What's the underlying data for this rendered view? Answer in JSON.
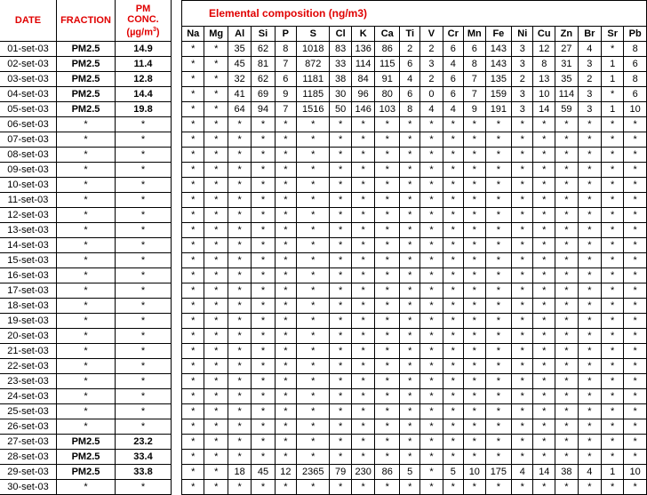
{
  "left_headers": {
    "date": "DATE",
    "fraction": "FRACTION",
    "pm_line1": "PM",
    "pm_line2": "CONC.",
    "pm_unit": "(µg/m",
    "pm_unit_sup": "3",
    "pm_unit_close": ")"
  },
  "composition_title": "Elemental composition (ng/m3)",
  "elements": [
    "Na",
    "Mg",
    "Al",
    "Si",
    "P",
    "S",
    "Cl",
    "K",
    "Ca",
    "Ti",
    "V",
    "Cr",
    "Mn",
    "Fe",
    "Ni",
    "Cu",
    "Zn",
    "Br",
    "Sr",
    "Pb"
  ],
  "rows": [
    {
      "date": "01-set-03",
      "fraction": "PM2.5",
      "conc": "14.9",
      "values": [
        "*",
        "*",
        "35",
        "62",
        "8",
        "1018",
        "83",
        "136",
        "86",
        "2",
        "2",
        "6",
        "6",
        "143",
        "3",
        "12",
        "27",
        "4",
        "*",
        "8"
      ]
    },
    {
      "date": "02-set-03",
      "fraction": "PM2.5",
      "conc": "11.4",
      "values": [
        "*",
        "*",
        "45",
        "81",
        "7",
        "872",
        "33",
        "114",
        "115",
        "6",
        "3",
        "4",
        "8",
        "143",
        "3",
        "8",
        "31",
        "3",
        "1",
        "6"
      ]
    },
    {
      "date": "03-set-03",
      "fraction": "PM2.5",
      "conc": "12.8",
      "values": [
        "*",
        "*",
        "32",
        "62",
        "6",
        "1181",
        "38",
        "84",
        "91",
        "4",
        "2",
        "6",
        "7",
        "135",
        "2",
        "13",
        "35",
        "2",
        "1",
        "8"
      ]
    },
    {
      "date": "04-set-03",
      "fraction": "PM2.5",
      "conc": "14.4",
      "values": [
        "*",
        "*",
        "41",
        "69",
        "9",
        "1185",
        "30",
        "96",
        "80",
        "6",
        "0",
        "6",
        "7",
        "159",
        "3",
        "10",
        "114",
        "3",
        "*",
        "6"
      ]
    },
    {
      "date": "05-set-03",
      "fraction": "PM2.5",
      "conc": "19.8",
      "values": [
        "*",
        "*",
        "64",
        "94",
        "7",
        "1516",
        "50",
        "146",
        "103",
        "8",
        "4",
        "4",
        "9",
        "191",
        "3",
        "14",
        "59",
        "3",
        "1",
        "10"
      ]
    },
    {
      "date": "06-set-03",
      "fraction": "*",
      "conc": "*",
      "values": [
        "*",
        "*",
        "*",
        "*",
        "*",
        "*",
        "*",
        "*",
        "*",
        "*",
        "*",
        "*",
        "*",
        "*",
        "*",
        "*",
        "*",
        "*",
        "*",
        "*"
      ]
    },
    {
      "date": "07-set-03",
      "fraction": "*",
      "conc": "*",
      "values": [
        "*",
        "*",
        "*",
        "*",
        "*",
        "*",
        "*",
        "*",
        "*",
        "*",
        "*",
        "*",
        "*",
        "*",
        "*",
        "*",
        "*",
        "*",
        "*",
        "*"
      ]
    },
    {
      "date": "08-set-03",
      "fraction": "*",
      "conc": "*",
      "values": [
        "*",
        "*",
        "*",
        "*",
        "*",
        "*",
        "*",
        "*",
        "*",
        "*",
        "*",
        "*",
        "*",
        "*",
        "*",
        "*",
        "*",
        "*",
        "*",
        "*"
      ]
    },
    {
      "date": "09-set-03",
      "fraction": "*",
      "conc": "*",
      "values": [
        "*",
        "*",
        "*",
        "*",
        "*",
        "*",
        "*",
        "*",
        "*",
        "*",
        "*",
        "*",
        "*",
        "*",
        "*",
        "*",
        "*",
        "*",
        "*",
        "*"
      ]
    },
    {
      "date": "10-set-03",
      "fraction": "*",
      "conc": "*",
      "values": [
        "*",
        "*",
        "*",
        "*",
        "*",
        "*",
        "*",
        "*",
        "*",
        "*",
        "*",
        "*",
        "*",
        "*",
        "*",
        "*",
        "*",
        "*",
        "*",
        "*"
      ]
    },
    {
      "date": "11-set-03",
      "fraction": "*",
      "conc": "*",
      "values": [
        "*",
        "*",
        "*",
        "*",
        "*",
        "*",
        "*",
        "*",
        "*",
        "*",
        "*",
        "*",
        "*",
        "*",
        "*",
        "*",
        "*",
        "*",
        "*",
        "*"
      ]
    },
    {
      "date": "12-set-03",
      "fraction": "*",
      "conc": "*",
      "values": [
        "*",
        "*",
        "*",
        "*",
        "*",
        "*",
        "*",
        "*",
        "*",
        "*",
        "*",
        "*",
        "*",
        "*",
        "*",
        "*",
        "*",
        "*",
        "*",
        "*"
      ]
    },
    {
      "date": "13-set-03",
      "fraction": "*",
      "conc": "*",
      "values": [
        "*",
        "*",
        "*",
        "*",
        "*",
        "*",
        "*",
        "*",
        "*",
        "*",
        "*",
        "*",
        "*",
        "*",
        "*",
        "*",
        "*",
        "*",
        "*",
        "*"
      ]
    },
    {
      "date": "14-set-03",
      "fraction": "*",
      "conc": "*",
      "values": [
        "*",
        "*",
        "*",
        "*",
        "*",
        "*",
        "*",
        "*",
        "*",
        "*",
        "*",
        "*",
        "*",
        "*",
        "*",
        "*",
        "*",
        "*",
        "*",
        "*"
      ]
    },
    {
      "date": "15-set-03",
      "fraction": "*",
      "conc": "*",
      "values": [
        "*",
        "*",
        "*",
        "*",
        "*",
        "*",
        "*",
        "*",
        "*",
        "*",
        "*",
        "*",
        "*",
        "*",
        "*",
        "*",
        "*",
        "*",
        "*",
        "*"
      ]
    },
    {
      "date": "16-set-03",
      "fraction": "*",
      "conc": "*",
      "values": [
        "*",
        "*",
        "*",
        "*",
        "*",
        "*",
        "*",
        "*",
        "*",
        "*",
        "*",
        "*",
        "*",
        "*",
        "*",
        "*",
        "*",
        "*",
        "*",
        "*"
      ]
    },
    {
      "date": "17-set-03",
      "fraction": "*",
      "conc": "*",
      "values": [
        "*",
        "*",
        "*",
        "*",
        "*",
        "*",
        "*",
        "*",
        "*",
        "*",
        "*",
        "*",
        "*",
        "*",
        "*",
        "*",
        "*",
        "*",
        "*",
        "*"
      ]
    },
    {
      "date": "18-set-03",
      "fraction": "*",
      "conc": "*",
      "values": [
        "*",
        "*",
        "*",
        "*",
        "*",
        "*",
        "*",
        "*",
        "*",
        "*",
        "*",
        "*",
        "*",
        "*",
        "*",
        "*",
        "*",
        "*",
        "*",
        "*"
      ]
    },
    {
      "date": "19-set-03",
      "fraction": "*",
      "conc": "*",
      "values": [
        "*",
        "*",
        "*",
        "*",
        "*",
        "*",
        "*",
        "*",
        "*",
        "*",
        "*",
        "*",
        "*",
        "*",
        "*",
        "*",
        "*",
        "*",
        "*",
        "*"
      ]
    },
    {
      "date": "20-set-03",
      "fraction": "*",
      "conc": "*",
      "values": [
        "*",
        "*",
        "*",
        "*",
        "*",
        "*",
        "*",
        "*",
        "*",
        "*",
        "*",
        "*",
        "*",
        "*",
        "*",
        "*",
        "*",
        "*",
        "*",
        "*"
      ]
    },
    {
      "date": "21-set-03",
      "fraction": "*",
      "conc": "*",
      "values": [
        "*",
        "*",
        "*",
        "*",
        "*",
        "*",
        "*",
        "*",
        "*",
        "*",
        "*",
        "*",
        "*",
        "*",
        "*",
        "*",
        "*",
        "*",
        "*",
        "*"
      ]
    },
    {
      "date": "22-set-03",
      "fraction": "*",
      "conc": "*",
      "values": [
        "*",
        "*",
        "*",
        "*",
        "*",
        "*",
        "*",
        "*",
        "*",
        "*",
        "*",
        "*",
        "*",
        "*",
        "*",
        "*",
        "*",
        "*",
        "*",
        "*"
      ]
    },
    {
      "date": "23-set-03",
      "fraction": "*",
      "conc": "*",
      "values": [
        "*",
        "*",
        "*",
        "*",
        "*",
        "*",
        "*",
        "*",
        "*",
        "*",
        "*",
        "*",
        "*",
        "*",
        "*",
        "*",
        "*",
        "*",
        "*",
        "*"
      ]
    },
    {
      "date": "24-set-03",
      "fraction": "*",
      "conc": "*",
      "values": [
        "*",
        "*",
        "*",
        "*",
        "*",
        "*",
        "*",
        "*",
        "*",
        "*",
        "*",
        "*",
        "*",
        "*",
        "*",
        "*",
        "*",
        "*",
        "*",
        "*"
      ]
    },
    {
      "date": "25-set-03",
      "fraction": "*",
      "conc": "*",
      "values": [
        "*",
        "*",
        "*",
        "*",
        "*",
        "*",
        "*",
        "*",
        "*",
        "*",
        "*",
        "*",
        "*",
        "*",
        "*",
        "*",
        "*",
        "*",
        "*",
        "*"
      ]
    },
    {
      "date": "26-set-03",
      "fraction": "*",
      "conc": "*",
      "values": [
        "*",
        "*",
        "*",
        "*",
        "*",
        "*",
        "*",
        "*",
        "*",
        "*",
        "*",
        "*",
        "*",
        "*",
        "*",
        "*",
        "*",
        "*",
        "*",
        "*"
      ]
    },
    {
      "date": "27-set-03",
      "fraction": "PM2.5",
      "conc": "23.2",
      "values": [
        "*",
        "*",
        "*",
        "*",
        "*",
        "*",
        "*",
        "*",
        "*",
        "*",
        "*",
        "*",
        "*",
        "*",
        "*",
        "*",
        "*",
        "*",
        "*",
        "*"
      ]
    },
    {
      "date": "28-set-03",
      "fraction": "PM2.5",
      "conc": "33.4",
      "values": [
        "*",
        "*",
        "*",
        "*",
        "*",
        "*",
        "*",
        "*",
        "*",
        "*",
        "*",
        "*",
        "*",
        "*",
        "*",
        "*",
        "*",
        "*",
        "*",
        "*"
      ]
    },
    {
      "date": "29-set-03",
      "fraction": "PM2.5",
      "conc": "33.8",
      "values": [
        "*",
        "*",
        "18",
        "45",
        "12",
        "2365",
        "79",
        "230",
        "86",
        "5",
        "*",
        "5",
        "10",
        "175",
        "4",
        "14",
        "38",
        "4",
        "1",
        "10"
      ]
    },
    {
      "date": "30-set-03",
      "fraction": "*",
      "conc": "*",
      "values": [
        "*",
        "*",
        "*",
        "*",
        "*",
        "*",
        "*",
        "*",
        "*",
        "*",
        "*",
        "*",
        "*",
        "*",
        "*",
        "*",
        "*",
        "*",
        "*",
        "*"
      ]
    }
  ]
}
